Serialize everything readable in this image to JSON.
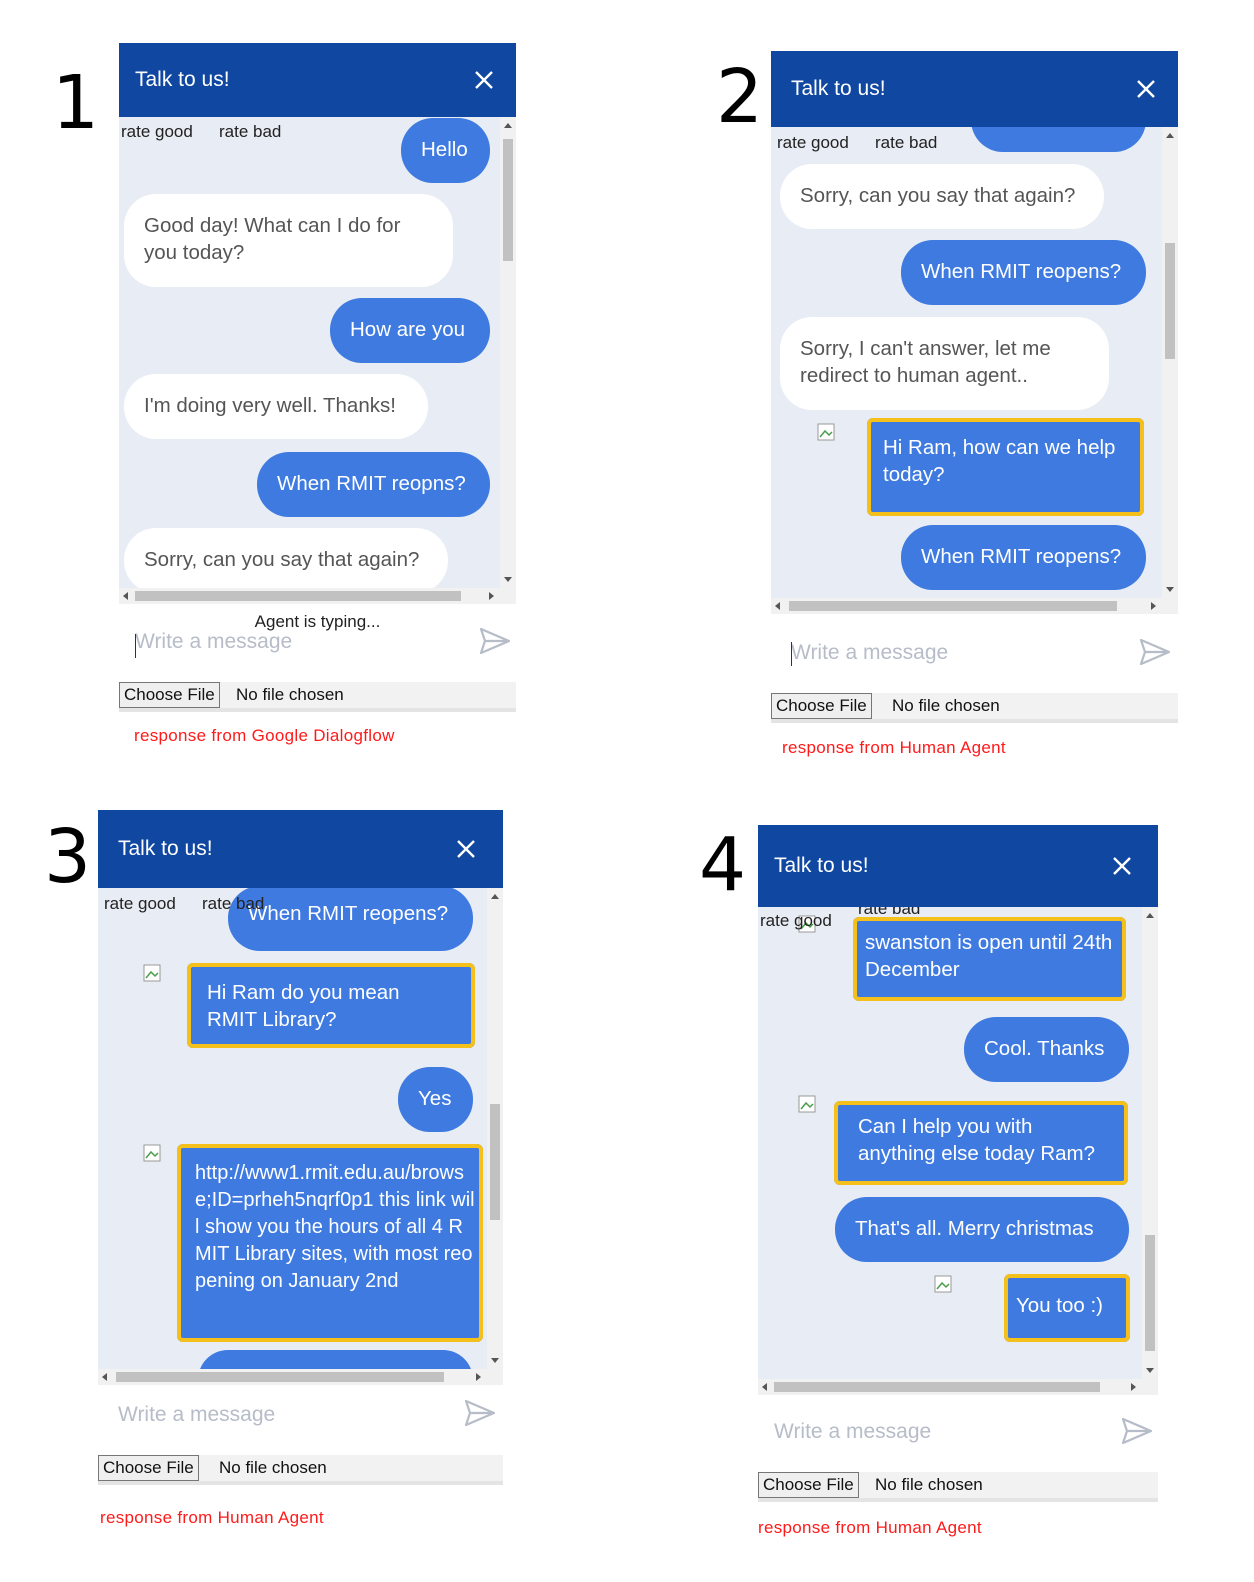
{
  "panels": [
    {
      "number": "1",
      "header_title": "Talk to us!",
      "rate_good": "rate good",
      "rate_bad": "rate bad",
      "messages": [
        "Hello",
        "Good day! What can I do for you today?",
        "How are you",
        "I'm doing very well. Thanks!",
        "When RMIT reopns?",
        "Sorry, can you say that again?"
      ],
      "typing_status": "Agent is typing...",
      "input_placeholder": "Write a message",
      "choose_file_label": "Choose File",
      "no_file_text": "No file chosen",
      "caption": "response from Google Dialogflow"
    },
    {
      "number": "2",
      "header_title": "Talk to us!",
      "rate_good": "rate good",
      "rate_bad": "rate bad",
      "messages": [
        "Sorry, can you say that again?",
        "When RMIT reopens?",
        "Sorry, I can't answer, let me redirect to human agent..",
        "Hi Ram, how can we help today?",
        "When RMIT reopens?"
      ],
      "input_placeholder": "Write a message",
      "choose_file_label": "Choose File",
      "no_file_text": "No file chosen",
      "caption": "response from Human Agent"
    },
    {
      "number": "3",
      "header_title": "Talk to us!",
      "rate_good": "rate good",
      "rate_bad": "rate bad",
      "messages": [
        "When RMIT reopens?",
        "Hi Ram do you mean RMIT Library?",
        "Yes",
        "http://www1.rmit.edu.au/browse;ID=prheh5nqrf0p1 this link will show you the hours of all 4 RMIT Library sites, with most reopening on January 2nd"
      ],
      "input_placeholder": "Write a message",
      "choose_file_label": "Choose File",
      "no_file_text": "No file chosen",
      "caption": "response from Human Agent"
    },
    {
      "number": "4",
      "header_title": "Talk to us!",
      "rate_good": "rate good",
      "rate_bad": "rate bad",
      "messages": [
        "swanston is open until 24th December",
        "Cool. Thanks",
        "Can I help you with anything else today Ram?",
        "That's all. Merry christmas",
        "You too :)"
      ],
      "input_placeholder": "Write a message",
      "choose_file_label": "Choose File",
      "no_file_text": "No file chosen",
      "caption": "response from Human Agent"
    }
  ]
}
